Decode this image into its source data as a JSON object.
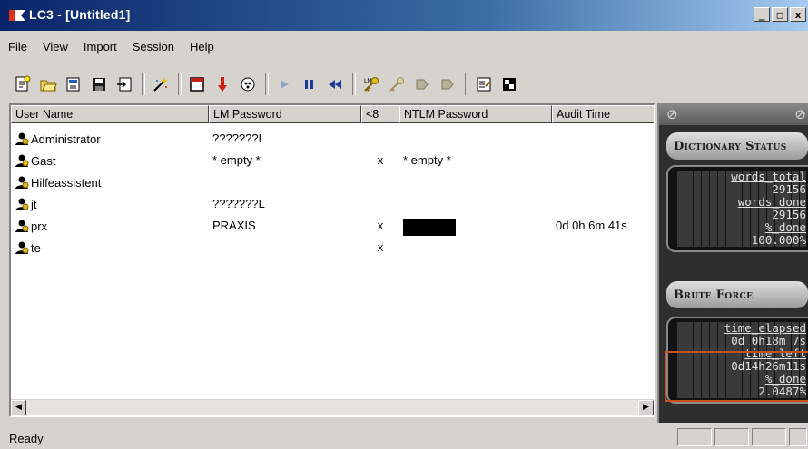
{
  "window": {
    "title": "LC3 - [Untitled1]"
  },
  "menu": [
    "File",
    "View",
    "Import",
    "Session",
    "Help"
  ],
  "toolbar_icons": [
    "new-session-icon",
    "open-icon",
    "import-icon",
    "save-icon",
    "export-icon",
    "wizard-icon",
    "window-icon",
    "download-icon",
    "dump-icon",
    "play-icon",
    "pause-icon",
    "rewind-icon",
    "key-icon",
    "key2-icon",
    "hash-icon",
    "hash2-icon",
    "properties-icon",
    "options-icon"
  ],
  "table": {
    "columns": [
      "User Name",
      "LM Password",
      "<8",
      "NTLM Password",
      "Audit Time"
    ],
    "rows": [
      {
        "user": "Administrator",
        "lm": "???????L",
        "lt8": "",
        "ntlm": "",
        "audit": ""
      },
      {
        "user": "Gast",
        "lm": "* empty *",
        "lt8": "x",
        "ntlm": "* empty *",
        "audit": ""
      },
      {
        "user": "Hilfeassistent",
        "lm": "",
        "lt8": "",
        "ntlm": "",
        "audit": ""
      },
      {
        "user": "jt",
        "lm": "???????L",
        "lt8": "",
        "ntlm": "",
        "audit": ""
      },
      {
        "user": "prx",
        "lm": "PRAXIS",
        "lt8": "x",
        "ntlm": "",
        "audit": "0d 0h 6m 41s"
      },
      {
        "user": "te",
        "lm": "",
        "lt8": "x",
        "ntlm": "",
        "audit": ""
      }
    ]
  },
  "status": {
    "text": "Ready"
  },
  "side": {
    "dictionary_title": "Dictionary Status",
    "words_total_label": "words_total",
    "words_total": "29156",
    "words_done_label": "words_done",
    "words_done": "29156",
    "pct_done_label": "%_done",
    "pct_done": "100.000%",
    "brute_title": "Brute Force",
    "time_elapsed_label": "time_elapsed",
    "time_elapsed": "0d_0h18m_7s",
    "time_left_label": "time_left",
    "time_left": "0d14h26m11s",
    "bf_pct_label": "%_done",
    "bf_pct": "2.0487%"
  }
}
